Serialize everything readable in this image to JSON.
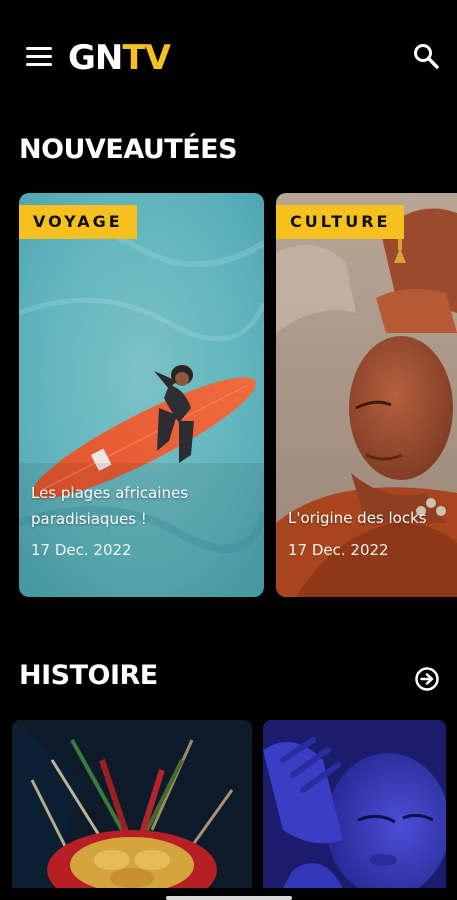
{
  "header": {
    "logo_part1": "GN",
    "logo_part2": "TV",
    "menu_icon": "hamburger-menu-icon",
    "search_icon": "search-icon"
  },
  "sections": {
    "nouveautees": {
      "title": "NOUVEAUTÉES",
      "cards": [
        {
          "category": "VOYAGE",
          "title": "Les plages africaines paradisiaques !",
          "date": "17 Dec. 2022"
        },
        {
          "category": "CULTURE",
          "title": "L'origine des locks",
          "date": "17 Dec. 2022"
        }
      ]
    },
    "histoire": {
      "title": "HISTOIRE",
      "more_icon": "arrow-circle-right-icon"
    }
  },
  "colors": {
    "accent": "#f6c01f",
    "background": "#000000",
    "text": "#ffffff"
  }
}
